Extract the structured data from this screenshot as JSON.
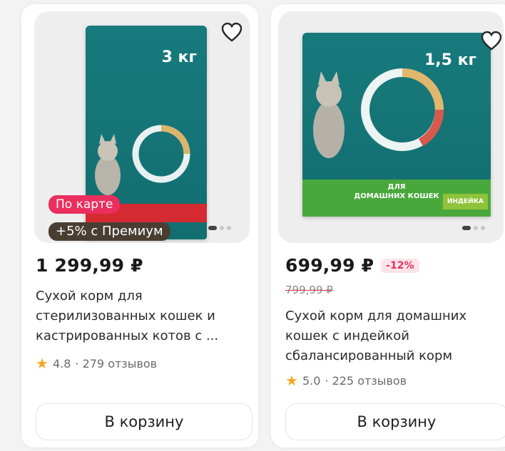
{
  "products": [
    {
      "weight": "3 кг",
      "badge_card": "По карте",
      "badge_premium": "+5% с Премиум",
      "price": "1 299,99 ₽",
      "title_line1": "Сухой корм для",
      "title_line2": "стерилизованных кошек и",
      "title_line3": "кастрированных котов с ...",
      "rating": "4.8",
      "reviews": "· 279 отзывов",
      "cart_label": "В корзину"
    },
    {
      "weight": "1,5 кг",
      "band_text_1": "ДЛЯ",
      "band_text_2": "ДОМАШНИХ КОШЕК",
      "tag_text": "ИНДЕЙКА",
      "price": "699,99 ₽",
      "discount": "-12%",
      "old_price": "799,99 ₽",
      "title_line1": "Сухой корм для домашних",
      "title_line2": "кошек с индейкой",
      "title_line3": "сбалансированный корм",
      "rating": "5.0",
      "reviews": "· 225 отзывов",
      "cart_label": "В корзину"
    }
  ],
  "colors": {
    "bag_teal": "#177a7c",
    "card_badge": "#ea2f5e",
    "premium_badge": "#4a3e33",
    "discount_text": "#e8305e",
    "star": "#f5a623"
  },
  "icons": [
    "heart-icon",
    "star-icon",
    "cat-image"
  ]
}
